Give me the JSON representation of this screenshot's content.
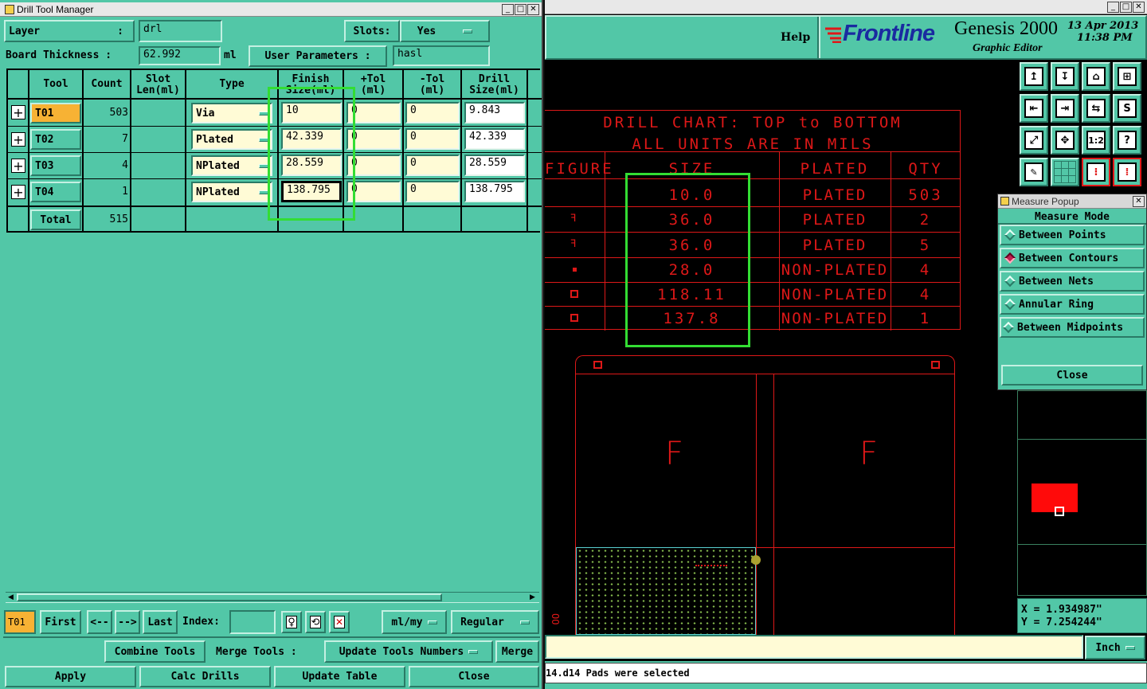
{
  "left_window": {
    "title": "Drill Tool Manager",
    "layer_label": "Layer",
    "layer_colon": ":",
    "layer_value": "drl",
    "slots_label": "Slots:",
    "slots_value": "Yes",
    "thickness_label": "Board Thickness :",
    "thickness_value": "62.992",
    "thickness_unit": "ml",
    "user_params_label": "User Parameters :",
    "user_params_value": "hasl",
    "headers": [
      "Tool",
      "Count",
      "Slot Len(ml)",
      "Type",
      "Finish Size(ml)",
      "+Tol (ml)",
      "-Tol (ml)",
      "Drill Size(ml)"
    ],
    "rows": [
      {
        "tool": "T01",
        "count": "503",
        "type": "Via",
        "finish": "10",
        "ptol": "0",
        "mtol": "0",
        "drill": "9.843"
      },
      {
        "tool": "T02",
        "count": "7",
        "type": "Plated",
        "finish": "42.339",
        "ptol": "0",
        "mtol": "0",
        "drill": "42.339"
      },
      {
        "tool": "T03",
        "count": "4",
        "type": "NPlated",
        "finish": "28.559",
        "ptol": "0",
        "mtol": "0",
        "drill": "28.559"
      },
      {
        "tool": "T04",
        "count": "1",
        "type": "NPlated",
        "finish": "138.795",
        "ptol": "0",
        "mtol": "0",
        "drill": "138.795"
      }
    ],
    "total_label": "Total",
    "total_count": "515",
    "nav": {
      "current": "T01",
      "first": "First",
      "prev": "<--",
      "next": "-->",
      "last": "Last",
      "index_label": "Index:",
      "units": "ml/my",
      "mode": "Regular"
    },
    "actions": {
      "combine": "Combine Tools",
      "merge_label": "Merge Tools :",
      "update_numbers": "Update Tools Numbers",
      "merge": "Merge",
      "apply": "Apply",
      "calc": "Calc Drills",
      "update_table": "Update Table",
      "close": "Close"
    }
  },
  "right_window": {
    "help": "Help",
    "logo": "Frontline",
    "product": "Genesis 2000",
    "subtitle": "Graphic Editor",
    "date": "13 Apr 2013",
    "time": "11:38 PM",
    "toolbar_icons": [
      "zoom-home-icon",
      "pan-down-icon",
      "home-icon",
      "window-icon",
      "pan-left-icon",
      "pan-right-icon",
      "back-forward-icon",
      "snake-icon",
      "fit-icon",
      "center-icon",
      "ratio-icon",
      "help-icon",
      "ruler-icon",
      "grid-icon",
      "layers-icon",
      "measure-icon"
    ],
    "ratio_label": "1:2",
    "help_glyph": "?",
    "measure_popup": {
      "title": "Measure Popup",
      "header": "Measure Mode",
      "options": [
        "Between Points",
        "Between Contours",
        "Between Nets",
        "Annular Ring",
        "Between Midpoints"
      ],
      "selected": "Between Contours",
      "close": "Close"
    },
    "coords": {
      "x": "X = 1.934987\"",
      "y": "Y = 7.254244\""
    },
    "unit": "Inch",
    "status": "14.d14 Pads were selected"
  },
  "drill_chart": {
    "title1": "DRILL CHART: TOP to BOTTOM",
    "title2": "ALL UNITS ARE IN MILS",
    "headers": [
      "FIGURE",
      "SIZE",
      "PLATED",
      "QTY"
    ],
    "rows": [
      {
        "size": "10.0",
        "plated": "PLATED",
        "qty": "503"
      },
      {
        "size": "36.0",
        "plated": "PLATED",
        "qty": "2"
      },
      {
        "size": "36.0",
        "plated": "PLATED",
        "qty": "5"
      },
      {
        "size": "28.0",
        "plated": "NON-PLATED",
        "qty": "4"
      },
      {
        "size": "118.11",
        "plated": "NON-PLATED",
        "qty": "4"
      },
      {
        "size": "137.8",
        "plated": "NON-PLATED",
        "qty": "1"
      }
    ],
    "board_letters": [
      "F",
      "F"
    ]
  },
  "colors": {
    "teal": "#52c7a7",
    "highlight": "#33dd33",
    "cad_red": "#dd1818",
    "selected_tool": "#f7b234"
  }
}
